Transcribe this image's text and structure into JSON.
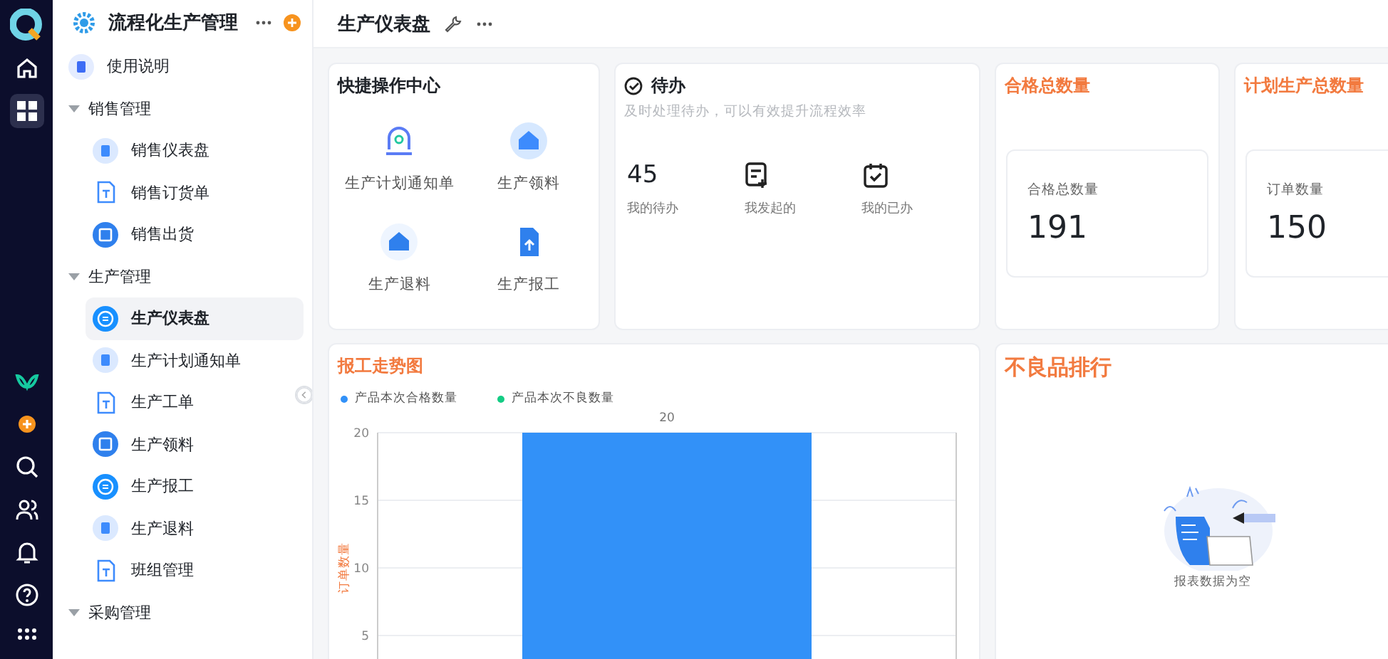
{
  "rail": {
    "items": [
      {
        "selected": false
      },
      {
        "selected": true
      }
    ]
  },
  "sidebar": {
    "app_title": "流程化生产管理",
    "items": [
      {
        "kind": "page",
        "label": "使用说明",
        "selected": false
      },
      {
        "kind": "group",
        "label": "销售管理",
        "expanded": true,
        "children": [
          {
            "label": "销售仪表盘",
            "selected": false
          },
          {
            "label": "销售订货单",
            "selected": false
          },
          {
            "label": "销售出货",
            "selected": false
          }
        ]
      },
      {
        "kind": "group",
        "label": "生产管理",
        "expanded": true,
        "children": [
          {
            "label": "生产仪表盘",
            "selected": true
          },
          {
            "label": "生产计划通知单",
            "selected": false
          },
          {
            "label": "生产工单",
            "selected": false
          },
          {
            "label": "生产领料",
            "selected": false
          },
          {
            "label": "生产报工",
            "selected": false
          },
          {
            "label": "生产退料",
            "selected": false
          },
          {
            "label": "班组管理",
            "selected": false
          }
        ]
      },
      {
        "kind": "group",
        "label": "采购管理",
        "expanded": true
      }
    ]
  },
  "header": {
    "title": "生产仪表盘"
  },
  "quick_actions": {
    "title": "快捷操作中心",
    "items": [
      {
        "label": "生产计划通知单"
      },
      {
        "label": "生产领料"
      },
      {
        "label": "生产退料"
      },
      {
        "label": "生产报工"
      }
    ]
  },
  "todo": {
    "title": "待办",
    "subtitle": "及时处理待办，可以有效提升流程效率",
    "stats": [
      {
        "kind": "count",
        "value": "45",
        "label": "我的待办"
      },
      {
        "kind": "icon",
        "label": "我发起的"
      },
      {
        "kind": "icon",
        "label": "我的已办"
      }
    ]
  },
  "stat_cards": [
    {
      "title": "合格总数量",
      "label": "合格总数量",
      "value": "191"
    },
    {
      "title": "计划生产总数量",
      "label": "订单数量",
      "value": "150"
    }
  ],
  "trend_chart": {
    "title": "报工走势图",
    "chart_data": {
      "type": "bar",
      "ylabel": "订单数量",
      "series": [
        {
          "name": "产品本次合格数量",
          "color": "#3291f8",
          "values": [
            20
          ]
        },
        {
          "name": "产品本次不良数量",
          "color": "#14cc84",
          "values": [
            null
          ]
        }
      ],
      "grid": true,
      "ylim": [
        0,
        20
      ],
      "yticks": [
        5,
        10,
        15,
        20
      ],
      "data_labels": true
    }
  },
  "defect_ranking": {
    "title": "不良品排行",
    "empty_text": "报表数据为空"
  }
}
